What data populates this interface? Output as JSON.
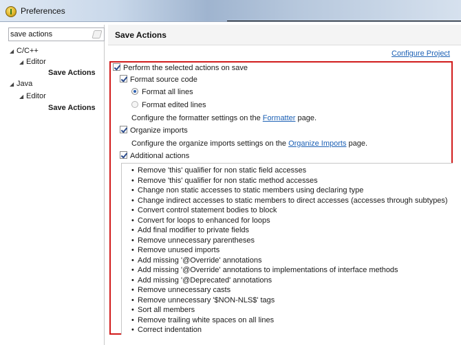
{
  "window": {
    "title": "Preferences"
  },
  "search": {
    "value": "save actions"
  },
  "tree": [
    {
      "label": "C/C++"
    },
    {
      "label": "Editor"
    },
    {
      "label": "Save Actions"
    },
    {
      "label": "Java"
    },
    {
      "label": "Editor"
    },
    {
      "label": "Save Actions"
    }
  ],
  "page": {
    "title": "Save Actions",
    "configure_link": "Configure Project"
  },
  "options": {
    "perform": {
      "label": "Perform the selected actions on save",
      "checked": true
    },
    "format": {
      "label": "Format source code",
      "checked": true
    },
    "format_all": {
      "label": "Format all lines",
      "selected": true
    },
    "format_edited": {
      "label": "Format edited lines",
      "selected": false
    },
    "formatter_note": {
      "prefix": "Configure the formatter settings on the ",
      "link": "Formatter",
      "suffix": " page."
    },
    "organize": {
      "label": "Organize imports",
      "checked": true
    },
    "organize_note": {
      "prefix": "Configure the organize imports settings on the ",
      "link": "Organize Imports",
      "suffix": " page."
    },
    "additional": {
      "label": "Additional actions",
      "checked": true
    }
  },
  "actions": [
    "Remove 'this' qualifier for non static field accesses",
    "Remove 'this' qualifier for non static method accesses",
    "Change non static accesses to static members using declaring type",
    "Change indirect accesses to static members to direct accesses (accesses through subtypes)",
    "Convert control statement bodies to block",
    "Convert for loops to enhanced for loops",
    "Add final modifier to private fields",
    "Remove unnecessary parentheses",
    "Remove unused imports",
    "Add missing '@Override' annotations",
    "Add missing '@Override' annotations to implementations of interface methods",
    "Add missing '@Deprecated' annotations",
    "Remove unnecessary casts",
    "Remove unnecessary '$NON-NLS$' tags",
    "Sort all members",
    "Remove trailing white spaces on all lines",
    "Correct indentation"
  ],
  "colors": {
    "highlight": "#d11a1a",
    "link": "#1a5fb4"
  }
}
